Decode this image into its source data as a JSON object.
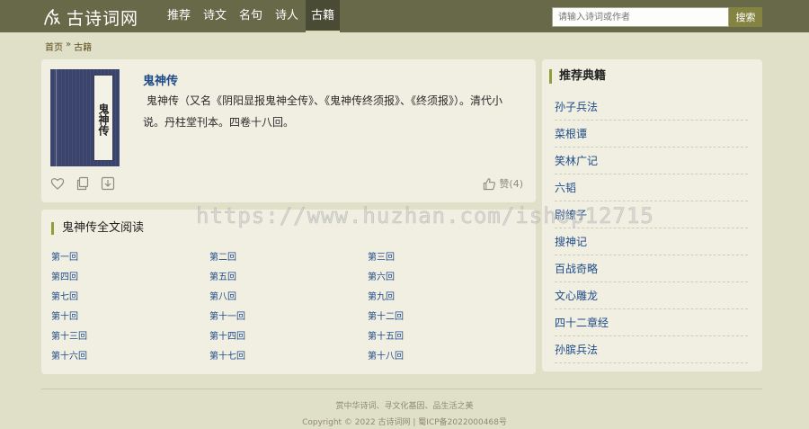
{
  "header": {
    "logo_text": "古诗词网",
    "nav": [
      "推荐",
      "诗文",
      "名句",
      "诗人",
      "古籍"
    ],
    "active_nav": 4,
    "search_placeholder": "请输入诗词或作者",
    "search_button": "搜索"
  },
  "breadcrumb": {
    "home": "首页",
    "separator": "»",
    "current": "古籍"
  },
  "book": {
    "cover_title": "鬼神传",
    "title": "鬼神传",
    "description": "鬼神传（又名《阴阳显报鬼神全传》、《鬼神传终须报》、《终须报》）。清代小说。丹柱堂刊本。四卷十八回。",
    "like_label": "赞(4)",
    "icons": [
      "heart-icon",
      "copy-icon",
      "download-icon",
      "thumbs-up-icon"
    ]
  },
  "chapters": {
    "heading": "鬼神传全文阅读",
    "items": [
      "第一回",
      "第二回",
      "第三回",
      "第四回",
      "第五回",
      "第六回",
      "第七回",
      "第八回",
      "第九回",
      "第十回",
      "第十一回",
      "第十二回",
      "第十三回",
      "第十四回",
      "第十五回",
      "第十六回",
      "第十七回",
      "第十八回"
    ]
  },
  "recommend": {
    "heading": "推荐典籍",
    "items": [
      "孙子兵法",
      "菜根谭",
      "笑林广记",
      "六韬",
      "尉缭子",
      "搜神记",
      "百战奇略",
      "文心雕龙",
      "四十二章经",
      "孙膑兵法"
    ]
  },
  "footer": {
    "slogan": "赏中华诗词、寻文化基因、品生活之美",
    "copyright": "Copyright © 2022 古诗词网 | 蜀ICP备2022000468号"
  },
  "watermark": "https://www.huzhan.com/ishop12715",
  "colors": {
    "header_bg": "#676949",
    "page_bg": "#e0dfc7",
    "card_bg": "#f0efe2",
    "link_blue": "#1e4a88",
    "accent_green": "#8ca03c",
    "search_button_bg": "#848341"
  }
}
